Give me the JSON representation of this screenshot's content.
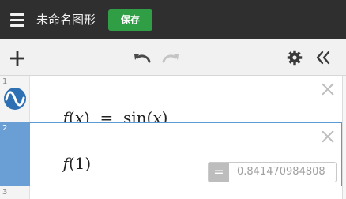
{
  "header": {
    "menu_icon": "hamburger-menu-icon",
    "title": "未命名图形",
    "save_label": "保存"
  },
  "toolbar": {
    "add_icon": "plus-icon",
    "undo_icon": "undo-icon",
    "redo_icon": "redo-icon",
    "settings_icon": "gear-icon",
    "collapse_icon": "double-chevron-left-icon"
  },
  "expressions": [
    {
      "index": "1",
      "icon": "desmos-wave-icon",
      "f": "f",
      "open": "(",
      "var": "x",
      "close": ")",
      "equals": "=",
      "func": "sin",
      "arg_open": "(",
      "arg": "x",
      "arg_close": ")"
    },
    {
      "index": "2",
      "f": "f",
      "open": "(",
      "arg": "1",
      "close": ")",
      "result_equals": "=",
      "result_value": "0.841470984808"
    },
    {
      "index": "3"
    }
  ],
  "colors": {
    "topbar": "#2f2f2f",
    "save_button": "#2f9e44",
    "active_gutter": "#6a9fd6",
    "active_border": "#5a9bd5",
    "wave_icon": "#2d70b3"
  }
}
